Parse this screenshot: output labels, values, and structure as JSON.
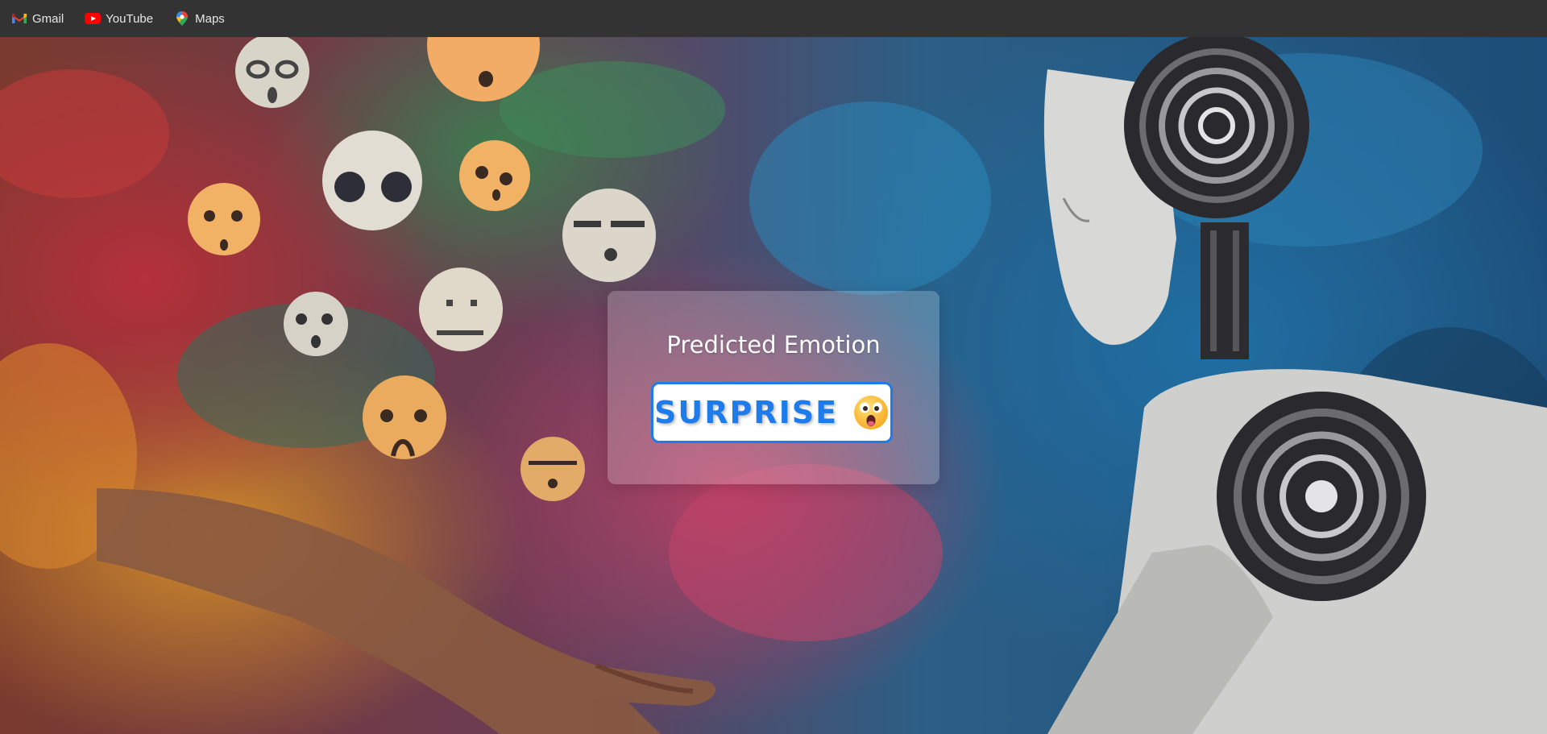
{
  "bookmarks": [
    {
      "label": "Gmail",
      "icon": "gmail-icon"
    },
    {
      "label": "YouTube",
      "icon": "youtube-icon"
    },
    {
      "label": "Maps",
      "icon": "maps-icon"
    }
  ],
  "card": {
    "title": "Predicted Emotion",
    "emotion": "SURPRISE",
    "emoji_icon": "surprised-face-icon"
  },
  "colors": {
    "accent": "#1e7bea",
    "bookmarks_bar": "#333333"
  }
}
